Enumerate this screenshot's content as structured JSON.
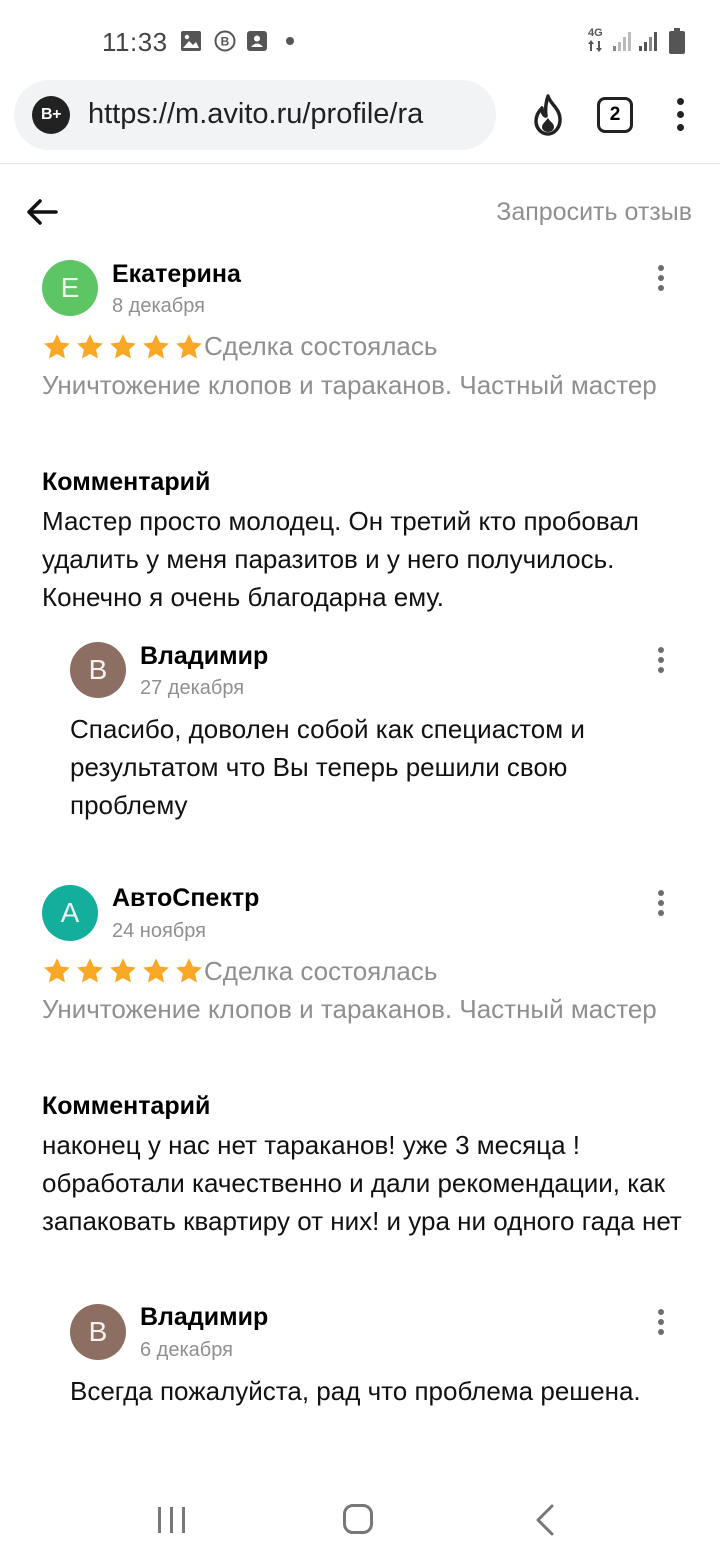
{
  "status_bar": {
    "time": "11:33",
    "network": "4G",
    "icons": [
      "image-icon",
      "b-circle-icon",
      "contact-card-icon",
      "dot-icon",
      "signal-icon",
      "signal-icon",
      "battery-icon"
    ]
  },
  "browser": {
    "site_badge": "B+",
    "url": "https://m.avito.ru/profile/ra",
    "tab_count": "2",
    "icons": [
      "flame-icon",
      "tabs-icon",
      "more-vert-icon"
    ]
  },
  "header": {
    "request_review": "Запросить отзыв"
  },
  "colors": {
    "star": "#f9a825",
    "avatar_green": "#5dc563",
    "avatar_teal": "#14ae9c",
    "avatar_brown": "#8d6e63",
    "muted_text": "#8f8f8f"
  },
  "reviews": [
    {
      "avatar_letter": "Е",
      "author": "Екатерина",
      "date": "8 декабря",
      "rating": 5,
      "deal_status": "Сделка состоялась",
      "service": "Уничтожение клопов и тараканов. Частный мастер",
      "comment_heading": "Комментарий",
      "comment": "Мастер просто молодец. Он третий кто пробовал удалить у меня паразитов и у него получилось. Конечно я очень благодарна ему.",
      "reply": {
        "avatar_letter": "В",
        "author": "Владимир",
        "date": "27 декабря",
        "text": "Спасибо, доволен собой как специастом и результатом что Вы теперь решили свою проблему"
      }
    },
    {
      "avatar_letter": "А",
      "author": "АвтоСпектр",
      "date": "24 ноября",
      "rating": 5,
      "deal_status": "Сделка состоялась",
      "service": "Уничтожение клопов и тараканов. Частный мастер",
      "comment_heading": "Комментарий",
      "comment": "наконец у нас нет тараканов! уже 3 месяца ! обработали качественно и дали рекомендации, как запаковать квартиру от них! и ура ни одного гада нет",
      "reply": {
        "avatar_letter": "В",
        "author": "Владимир",
        "date": "6 декабря",
        "text": "Всегда пожалуйста, рад что проблема решена."
      }
    }
  ]
}
